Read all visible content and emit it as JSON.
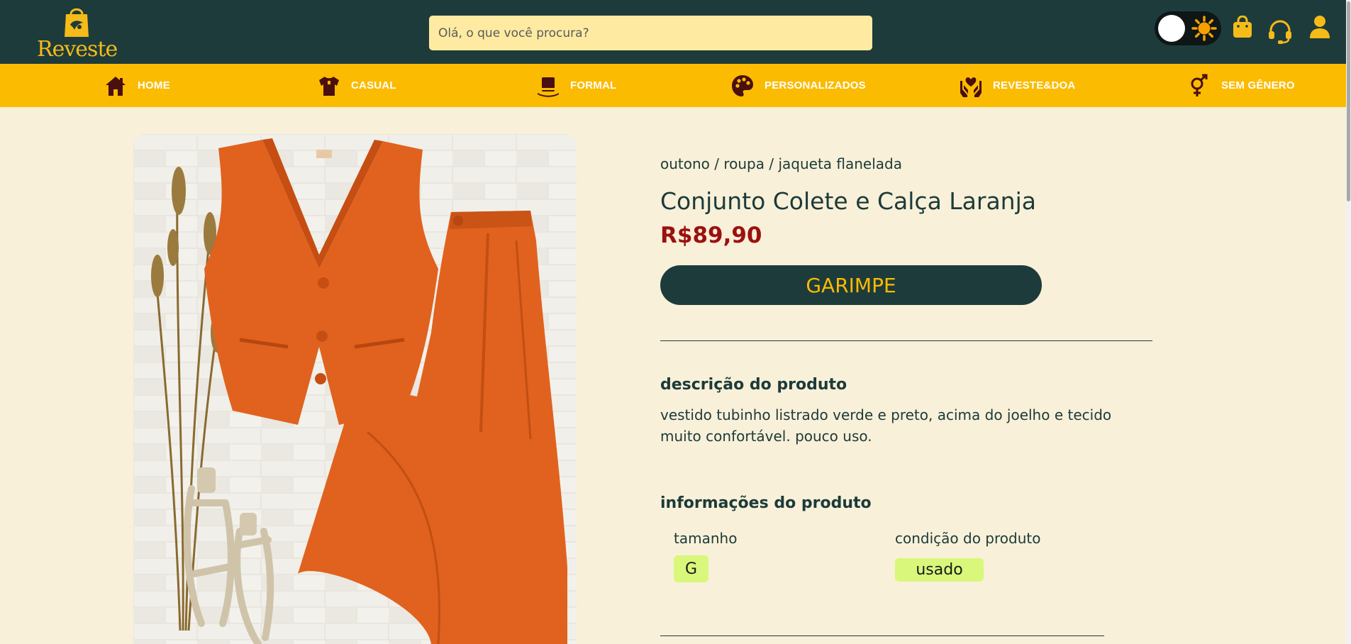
{
  "header": {
    "brand": "Reveste",
    "search_placeholder": "Olá, o que você procura?"
  },
  "nav": [
    {
      "label": "HOME",
      "icon": "home-icon"
    },
    {
      "label": "CASUAL",
      "icon": "shirt-icon"
    },
    {
      "label": "FORMAL",
      "icon": "top-hat-icon"
    },
    {
      "label": "PERSONALIZADOS",
      "icon": "palette-icon"
    },
    {
      "label": "REVESTE&DOA",
      "icon": "hands-heart-icon"
    },
    {
      "label": "SEM GÊNERO",
      "icon": "gender-icon"
    }
  ],
  "product": {
    "image_alt": "Conjunto colete e calça laranja",
    "breadcrumb": "outono / roupa / jaqueta flanelada",
    "title": "Conjunto Colete e Calça Laranja",
    "price": "R$89,90",
    "cta_label": "GARIMPE",
    "description_title": "descrição do produto",
    "description": "vestido tubinho listrado verde e preto, acima do joelho e tecido muito confortável. pouco uso.",
    "info_title": "informações do produto",
    "size_label": "tamanho",
    "size_value": "G",
    "condition_label": "condição do produto",
    "condition_value": "usado"
  },
  "colors": {
    "header_bg": "#1e3b3b",
    "nav_bg": "#fbbb00",
    "page_bg": "#f8f0d8",
    "price": "#9c1010",
    "accent": "#f5bb19",
    "badge_bg": "#d9f77a"
  }
}
